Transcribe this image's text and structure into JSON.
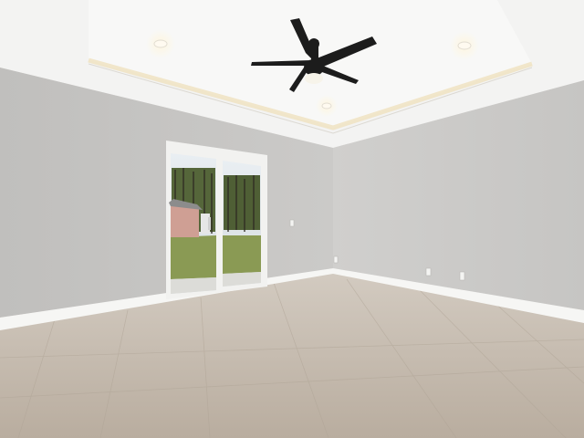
{
  "scene": {
    "kind": "empty-room-interior",
    "colors": {
      "ceiling": "#f4f4f3",
      "tray_ceiling": "#f8f8f7",
      "left_wall": "#c4c3c1",
      "right_wall": "#cacac8",
      "floor": "#c2b7aa",
      "baseboard": "#f6f6f4",
      "fan": "#1c1c1c",
      "door_frame": "#f2f2f0",
      "grass": "#8a9a54",
      "shed": "#cf9f94"
    },
    "icons": [
      "ceiling-fan-icon",
      "recessed-light-icon",
      "electrical-outlet-icon",
      "light-switch-icon"
    ]
  }
}
